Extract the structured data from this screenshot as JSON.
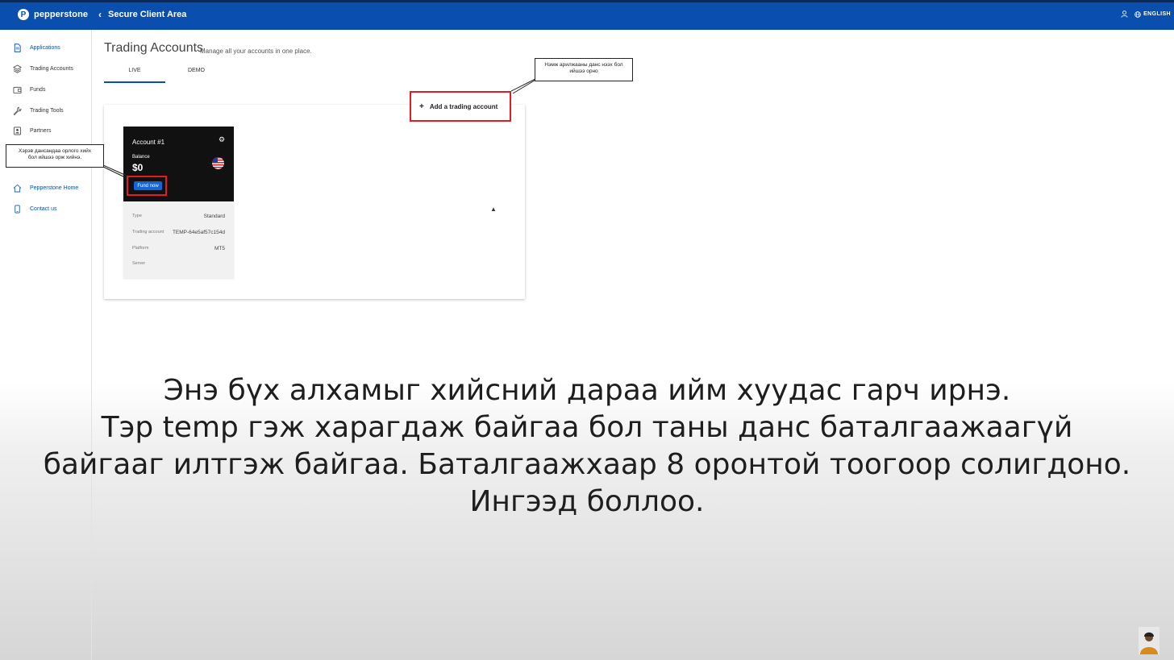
{
  "header": {
    "brand": "pepperstone",
    "back_title": "Secure Client Area",
    "language": "ENGLISH"
  },
  "sidebar": {
    "items": [
      {
        "label": "Applications",
        "icon": "document-icon"
      },
      {
        "label": "Trading Accounts",
        "icon": "layers-icon"
      },
      {
        "label": "Funds",
        "icon": "wallet-icon"
      },
      {
        "label": "Trading Tools",
        "icon": "wrench-icon"
      },
      {
        "label": "Partners",
        "icon": "id-card-icon"
      }
    ],
    "links": [
      {
        "label": "Pepperstone Home",
        "icon": "home-icon"
      },
      {
        "label": "Contact us",
        "icon": "phone-icon"
      }
    ]
  },
  "main": {
    "title": "Trading Accounts",
    "subtitle": "Manage all your accounts in one place.",
    "tabs": [
      {
        "label": "LIVE"
      },
      {
        "label": "DEMO"
      }
    ],
    "add_account": "Add a trading account",
    "add_account_icon": "+"
  },
  "account_card": {
    "name": "Account #1",
    "balance_label": "Balance",
    "balance": "$0",
    "fund_button": "Fund now",
    "rows": [
      {
        "label": "Type",
        "value": "Standard"
      },
      {
        "label": "Trading account",
        "value": "TEMP-64e5af57c154d"
      },
      {
        "label": "Platform",
        "value": "MT5"
      },
      {
        "label": "Server",
        "value": ""
      }
    ]
  },
  "callouts": {
    "add_account_note": "Нэмж арилжааны данс нээх бол\nийшээ орно",
    "fund_note": "Хэрэв дансандаа орлого хийх\nбол ийшээ орж хийнэ."
  },
  "caption": {
    "lines": [
      "Энэ бүх алхамыг хийсний дараа ийм хуудас гарч ирнэ.",
      "Тэр temp гэж харагдаж байгаа бол таны данс баталгаажаагүй",
      "байгааг илтгэж байгаа. Баталгаажхаар 8 оронтой тоогоор солигдоно.",
      "Ингээд боллоо."
    ]
  },
  "colors": {
    "header_bg": "#0a4fae",
    "accent": "#0a4fae",
    "highlight_red": "#e31b23",
    "fund_button": "#1565d8"
  }
}
